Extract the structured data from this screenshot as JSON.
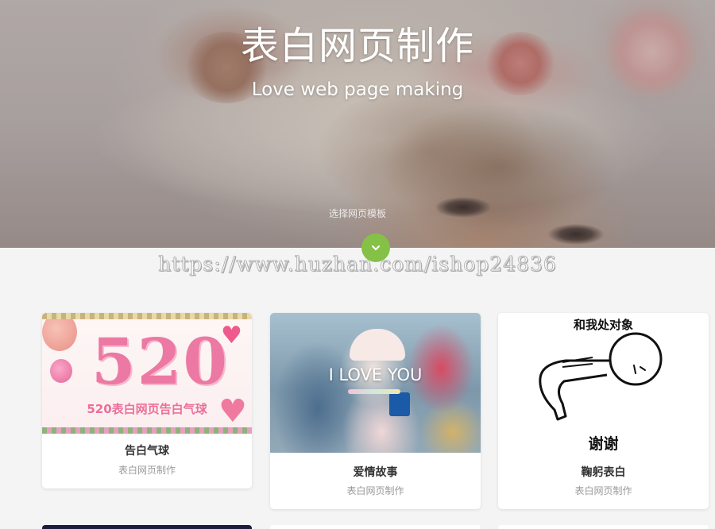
{
  "hero": {
    "title": "表白网页制作",
    "subtitle": "Love web page making",
    "hint": "选择网页模板",
    "scroll_icon": "chevron-down-icon"
  },
  "watermark": "https://www.huzhan.com/ishop24836",
  "cards": [
    {
      "title": "告白气球",
      "subtitle": "表白网页制作",
      "image": {
        "big_text": "520",
        "caption": "520表白网页告白气球"
      }
    },
    {
      "title": "爱情故事",
      "subtitle": "表白网页制作",
      "image": {
        "overlay_text": "I LOVE YOU"
      }
    },
    {
      "title": "鞠躬表白",
      "subtitle": "表白网页制作",
      "image": {
        "top_text": "和我处对象",
        "bottom_text": "谢谢"
      }
    }
  ],
  "colors": {
    "accent": "#85c147",
    "card_title": "#333333",
    "card_subtitle": "#999999",
    "background": "#f4f4f4"
  }
}
